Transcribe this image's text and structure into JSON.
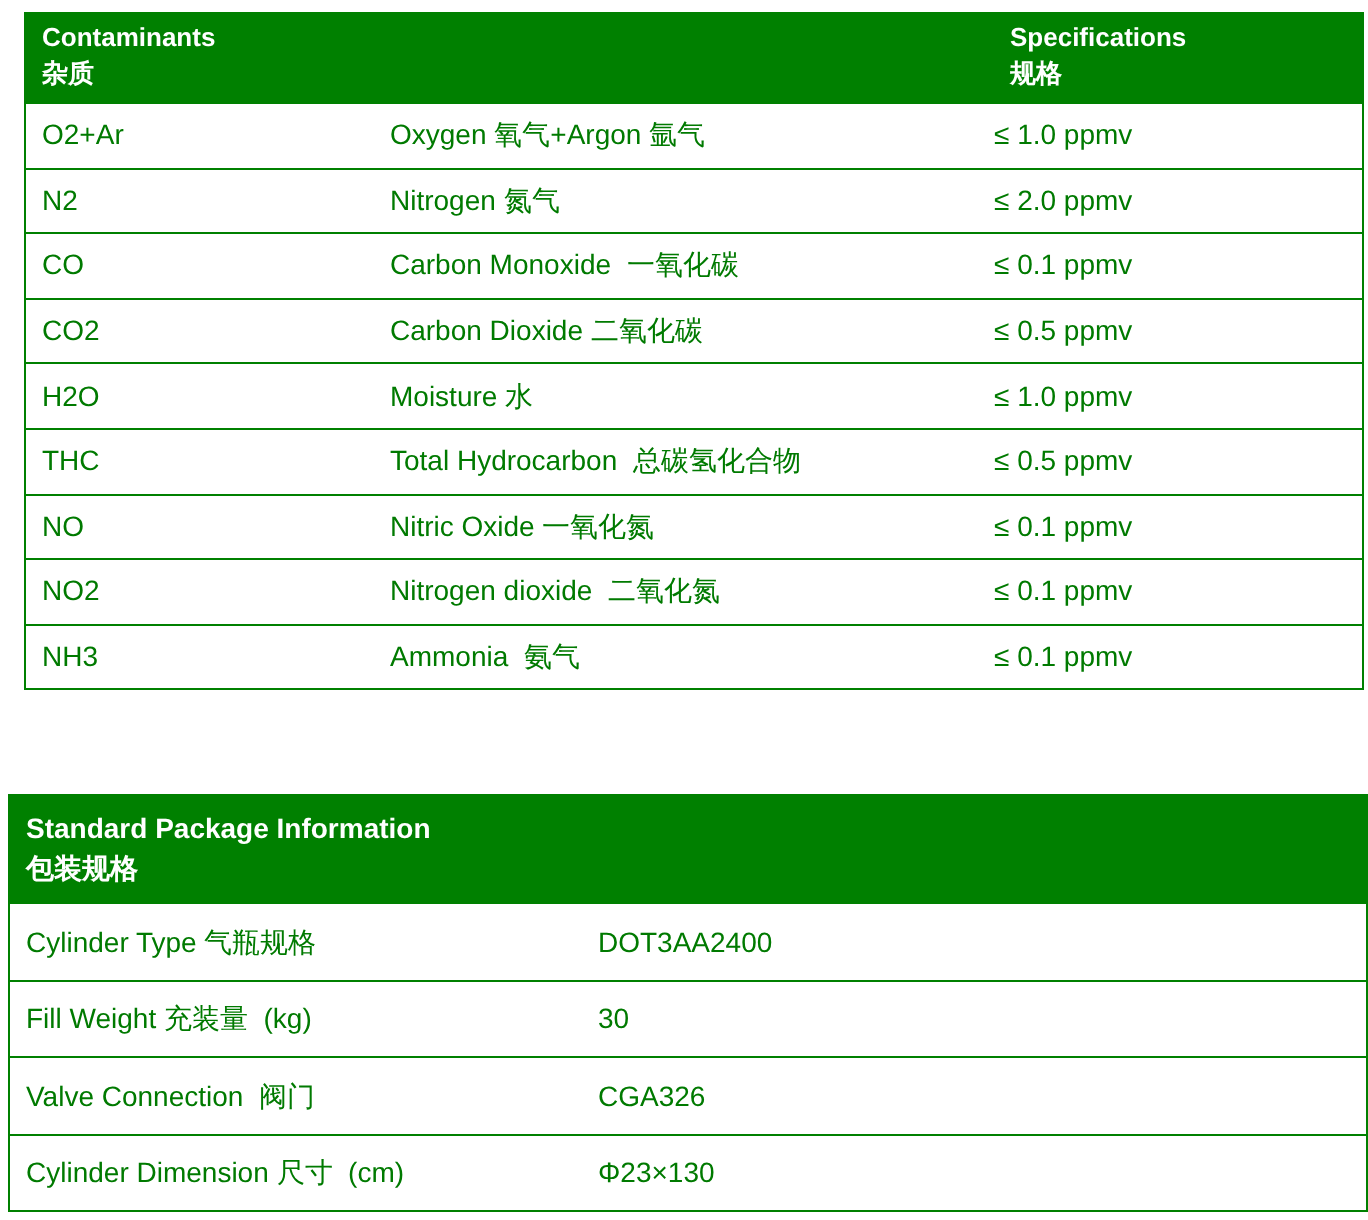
{
  "contaminants_table": {
    "columns": [
      {
        "en": "Contaminants",
        "zh": "杂质"
      },
      {
        "en": "Specifications",
        "zh": "规格"
      }
    ],
    "rows": [
      {
        "code": "O2+Ar",
        "name": "Oxygen 氧气+Argon 氩气",
        "spec": "≤ 1.0 ppmv"
      },
      {
        "code": "N2",
        "name": "Nitrogen 氮气",
        "spec": "≤ 2.0 ppmv"
      },
      {
        "code": "CO",
        "name": "Carbon Monoxide  一氧化碳",
        "spec": "≤ 0.1 ppmv"
      },
      {
        "code": "CO2",
        "name": "Carbon Dioxide 二氧化碳",
        "spec": "≤ 0.5 ppmv"
      },
      {
        "code": "H2O",
        "name": "Moisture 水",
        "spec": "≤ 1.0 ppmv"
      },
      {
        "code": "THC",
        "name": "Total Hydrocarbon  总碳氢化合物",
        "spec": "≤ 0.5 ppmv"
      },
      {
        "code": "NO",
        "name": "Nitric Oxide 一氧化氮",
        "spec": "≤ 0.1 ppmv"
      },
      {
        "code": "NO2",
        "name": "Nitrogen dioxide  二氧化氮",
        "spec": "≤ 0.1 ppmv"
      },
      {
        "code": "NH3",
        "name": "Ammonia  氨气",
        "spec": "≤ 0.1 ppmv"
      }
    ]
  },
  "package_table": {
    "title": {
      "en": "Standard Package Information",
      "zh": "包装规格"
    },
    "rows": [
      {
        "label": "Cylinder Type 气瓶规格",
        "value": "DOT3AA2400"
      },
      {
        "label": "Fill Weight 充装量  (kg)",
        "value": "30"
      },
      {
        "label": "Valve Connection  阀门",
        "value": "CGA326"
      },
      {
        "label": "Cylinder Dimension 尺寸  (cm)",
        "value": "Φ23×130"
      }
    ]
  }
}
